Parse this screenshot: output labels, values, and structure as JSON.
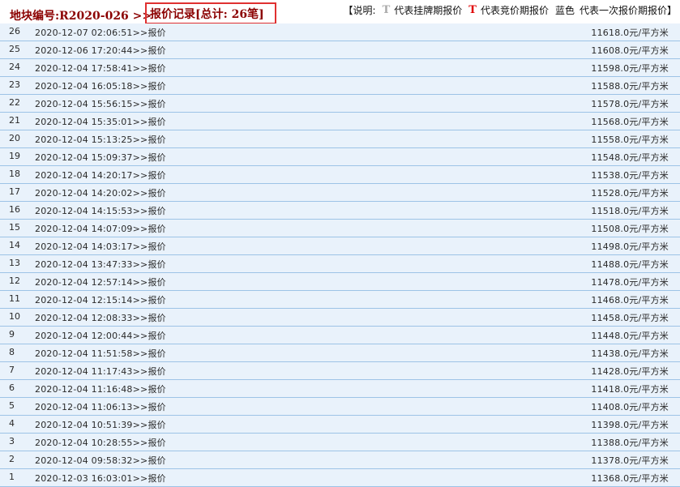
{
  "header": {
    "plot_label": "地块编号:R2020-026 >>",
    "record_title": "报价记录[总计: 26笔]",
    "legend": {
      "prefix": "【说明:",
      "icon_listing": "T",
      "listing_text": "代表挂牌期报价",
      "icon_bidding": "T",
      "bidding_text": "代表竞价期报价",
      "blue_text": "蓝色",
      "blue_desc": "代表一次报价期报价】"
    }
  },
  "colors": {
    "title_red": "#8b0000",
    "box_red": "#e03030",
    "row_bg": "#e9f2fb",
    "row_border": "#9dc3e6",
    "listing_icon": "#aaaaaa",
    "bidding_icon": "#e00000"
  },
  "records": [
    {
      "index": "26",
      "time": "2020-12-07 02:06:51>>报价",
      "price": "11618.0元/平方米"
    },
    {
      "index": "25",
      "time": "2020-12-06 17:20:44>>报价",
      "price": "11608.0元/平方米"
    },
    {
      "index": "24",
      "time": "2020-12-04 17:58:41>>报价",
      "price": "11598.0元/平方米"
    },
    {
      "index": "23",
      "time": "2020-12-04 16:05:18>>报价",
      "price": "11588.0元/平方米"
    },
    {
      "index": "22",
      "time": "2020-12-04 15:56:15>>报价",
      "price": "11578.0元/平方米"
    },
    {
      "index": "21",
      "time": "2020-12-04 15:35:01>>报价",
      "price": "11568.0元/平方米"
    },
    {
      "index": "20",
      "time": "2020-12-04 15:13:25>>报价",
      "price": "11558.0元/平方米"
    },
    {
      "index": "19",
      "time": "2020-12-04 15:09:37>>报价",
      "price": "11548.0元/平方米"
    },
    {
      "index": "18",
      "time": "2020-12-04 14:20:17>>报价",
      "price": "11538.0元/平方米"
    },
    {
      "index": "17",
      "time": "2020-12-04 14:20:02>>报价",
      "price": "11528.0元/平方米"
    },
    {
      "index": "16",
      "time": "2020-12-04 14:15:53>>报价",
      "price": "11518.0元/平方米"
    },
    {
      "index": "15",
      "time": "2020-12-04 14:07:09>>报价",
      "price": "11508.0元/平方米"
    },
    {
      "index": "14",
      "time": "2020-12-04 14:03:17>>报价",
      "price": "11498.0元/平方米"
    },
    {
      "index": "13",
      "time": "2020-12-04 13:47:33>>报价",
      "price": "11488.0元/平方米"
    },
    {
      "index": "12",
      "time": "2020-12-04 12:57:14>>报价",
      "price": "11478.0元/平方米"
    },
    {
      "index": "11",
      "time": "2020-12-04 12:15:14>>报价",
      "price": "11468.0元/平方米"
    },
    {
      "index": "10",
      "time": "2020-12-04 12:08:33>>报价",
      "price": "11458.0元/平方米"
    },
    {
      "index": "9",
      "time": "2020-12-04 12:00:44>>报价",
      "price": "11448.0元/平方米"
    },
    {
      "index": "8",
      "time": "2020-12-04 11:51:58>>报价",
      "price": "11438.0元/平方米"
    },
    {
      "index": "7",
      "time": "2020-12-04 11:17:43>>报价",
      "price": "11428.0元/平方米"
    },
    {
      "index": "6",
      "time": "2020-12-04 11:16:48>>报价",
      "price": "11418.0元/平方米"
    },
    {
      "index": "5",
      "time": "2020-12-04 11:06:13>>报价",
      "price": "11408.0元/平方米"
    },
    {
      "index": "4",
      "time": "2020-12-04 10:51:39>>报价",
      "price": "11398.0元/平方米"
    },
    {
      "index": "3",
      "time": "2020-12-04 10:28:55>>报价",
      "price": "11388.0元/平方米"
    },
    {
      "index": "2",
      "time": "2020-12-04 09:58:32>>报价",
      "price": "11378.0元/平方米"
    },
    {
      "index": "1",
      "time": "2020-12-03 16:03:01>>报价",
      "price": "11368.0元/平方米"
    }
  ]
}
